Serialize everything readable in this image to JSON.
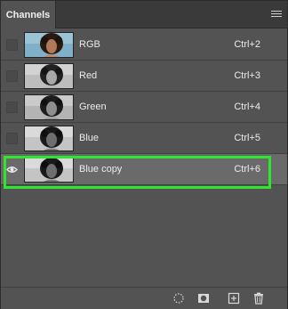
{
  "panel": {
    "tab_label": "Channels",
    "menu_icon": "hamburger-menu-icon"
  },
  "channels": [
    {
      "name": "RGB",
      "shortcut": "Ctrl+2",
      "visible": false,
      "thumb": "color"
    },
    {
      "name": "Red",
      "shortcut": "Ctrl+3",
      "visible": false,
      "thumb": "gray"
    },
    {
      "name": "Green",
      "shortcut": "Ctrl+4",
      "visible": false,
      "thumb": "gray"
    },
    {
      "name": "Blue",
      "shortcut": "Ctrl+5",
      "visible": false,
      "thumb": "gray"
    },
    {
      "name": "Blue copy",
      "shortcut": "Ctrl+6",
      "visible": true,
      "thumb": "gray",
      "selected": true
    }
  ],
  "footer": {
    "buttons": [
      "load-selection-icon",
      "save-selection-mask-icon",
      "new-channel-icon",
      "delete-channel-icon"
    ]
  },
  "colors": {
    "highlight": "#2ee62e",
    "panel_bg": "#535353",
    "selected_row": "#6a6a6a"
  }
}
